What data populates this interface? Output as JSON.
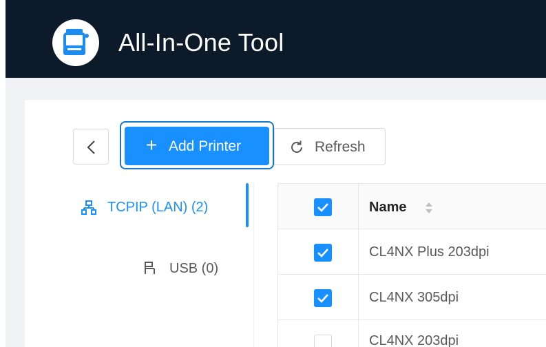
{
  "app": {
    "title": "All-In-One Tool",
    "logo_icon": "printer-icon"
  },
  "toolbar": {
    "back_icon": "chevron-left-icon",
    "add_icon": "plus-icon",
    "add_label": "Add Printer",
    "refresh_icon": "refresh-icon",
    "refresh_label": "Refresh"
  },
  "tabs": [
    {
      "icon": "network-icon",
      "label": "TCPIP (LAN) (2)",
      "active": true
    },
    {
      "icon": "usb-icon",
      "label": "USB (0)",
      "active": false
    }
  ],
  "table": {
    "header_checked": true,
    "columns": [
      {
        "label": "Name",
        "sortable": true
      }
    ],
    "rows": [
      {
        "checked": true,
        "name": "CL4NX Plus 203dpi"
      },
      {
        "checked": true,
        "name": "CL4NX 305dpi"
      },
      {
        "checked": false,
        "name": "CL4NX 203dpi"
      }
    ]
  },
  "colors": {
    "header_bg": "#0c1a2a",
    "accent": "#1890ff",
    "page_bg": "#f0f2f5"
  }
}
